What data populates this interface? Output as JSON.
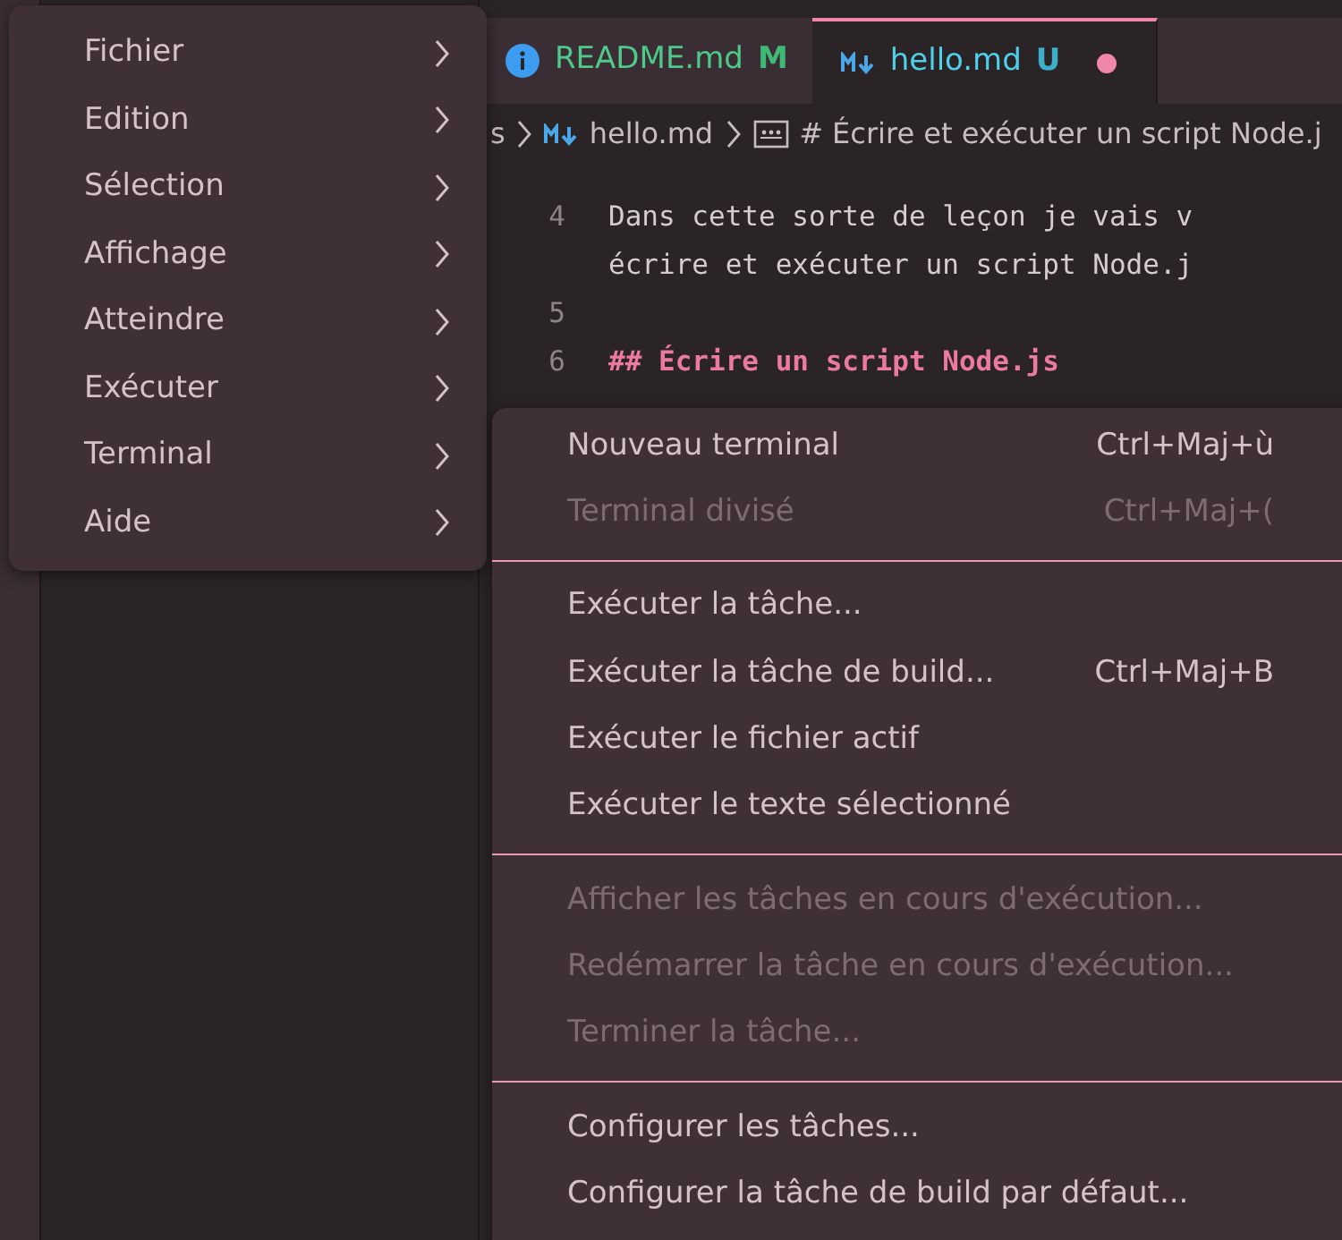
{
  "tabs": [
    {
      "label": "README.md",
      "badge": "M",
      "kind": "info",
      "selected": false,
      "dirty": false
    },
    {
      "label": "hello.md",
      "badge": "U",
      "kind": "markdown",
      "selected": true,
      "dirty": true
    }
  ],
  "breadcrumb": [
    {
      "label": "s",
      "kind": "text"
    },
    {
      "label": "hello.md",
      "kind": "markdown"
    },
    {
      "label": "# Écrire et exécuter un script Node.j",
      "kind": "string"
    }
  ],
  "code_lines": [
    {
      "number": "4",
      "text": "Dans cette sorte de leçon je vais v",
      "kind": "text"
    },
    {
      "text": "écrire et exécuter un script Node.j",
      "kind": "text"
    },
    {
      "number": "5"
    },
    {
      "number": "6",
      "text": "## Écrire un script Node.js",
      "kind": "heading"
    }
  ],
  "main_menu": [
    {
      "label": "Fichier"
    },
    {
      "label": "Edition"
    },
    {
      "label": "Sélection"
    },
    {
      "label": "Affichage"
    },
    {
      "label": "Atteindre"
    },
    {
      "label": "Exécuter"
    },
    {
      "label": "Terminal"
    },
    {
      "label": "Aide"
    }
  ],
  "submenu_groups": [
    [
      {
        "label": "Nouveau terminal",
        "shortcut": "Ctrl+Maj+ù",
        "disabled": false
      },
      {
        "label": "Terminal divisé",
        "shortcut": "Ctrl+Maj+(",
        "disabled": true
      }
    ],
    [
      {
        "label": "Exécuter la tâche...",
        "disabled": false
      },
      {
        "label": "Exécuter la tâche de build...",
        "shortcut": "Ctrl+Maj+B",
        "disabled": false
      },
      {
        "label": "Exécuter le fichier actif",
        "disabled": false
      },
      {
        "label": "Exécuter le texte sélectionné",
        "disabled": false
      }
    ],
    [
      {
        "label": "Afficher les tâches en cours d'exécution...",
        "disabled": true
      },
      {
        "label": "Redémarrer la tâche en cours d'exécution...",
        "disabled": true
      },
      {
        "label": "Terminer la tâche...",
        "disabled": true
      }
    ],
    [
      {
        "label": "Configurer les tâches...",
        "disabled": false
      },
      {
        "label": "Configurer la tâche de build par défaut...",
        "disabled": false
      }
    ]
  ]
}
